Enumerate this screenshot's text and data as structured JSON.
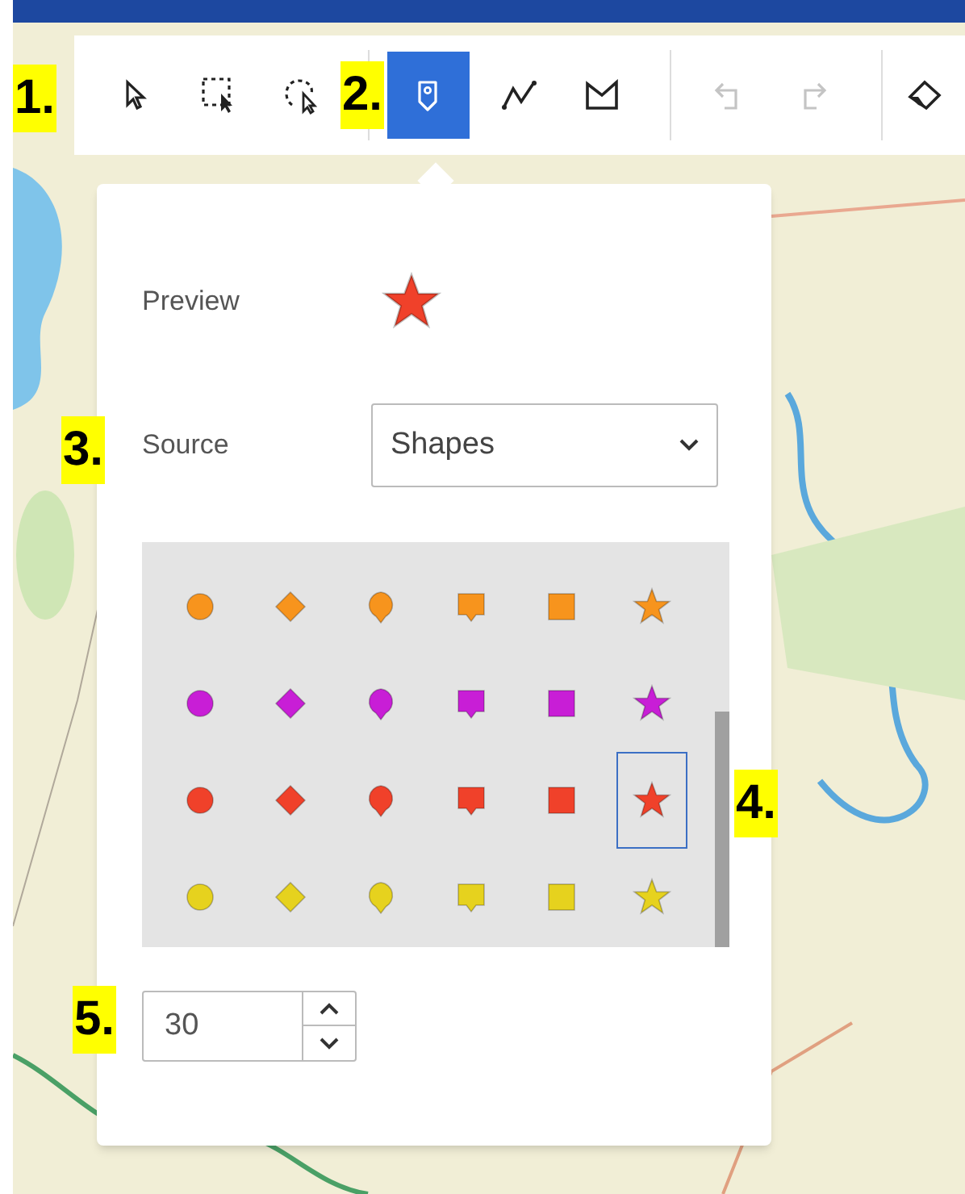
{
  "toolbar": {
    "tools": [
      {
        "kind": "select",
        "selected": false,
        "disabled": false
      },
      {
        "kind": "rectangle-select",
        "selected": false,
        "disabled": false
      },
      {
        "kind": "lasso-select",
        "selected": false,
        "disabled": false
      },
      {
        "kind": "point",
        "selected": true,
        "disabled": false
      },
      {
        "kind": "polyline",
        "selected": false,
        "disabled": false
      },
      {
        "kind": "polygon",
        "selected": false,
        "disabled": false
      },
      {
        "kind": "undo",
        "selected": false,
        "disabled": true
      },
      {
        "kind": "redo",
        "selected": false,
        "disabled": true
      },
      {
        "kind": "eraser",
        "selected": false,
        "disabled": false
      }
    ]
  },
  "symbol_panel": {
    "preview_label": "Preview",
    "preview": {
      "kind": "star",
      "color": "#f0412a"
    },
    "source_label": "Source",
    "source": {
      "value": "Shapes"
    },
    "symbols": [
      {
        "color": "#f7941d",
        "items": [
          {
            "kind": "circle",
            "selected": false
          },
          {
            "kind": "diamond",
            "selected": false
          },
          {
            "kind": "pin",
            "selected": false
          },
          {
            "kind": "callout",
            "selected": false
          },
          {
            "kind": "square",
            "selected": false
          },
          {
            "kind": "star",
            "selected": false
          }
        ]
      },
      {
        "color": "#c81ed6",
        "items": [
          {
            "kind": "circle",
            "selected": false
          },
          {
            "kind": "diamond",
            "selected": false
          },
          {
            "kind": "pin",
            "selected": false
          },
          {
            "kind": "callout",
            "selected": false
          },
          {
            "kind": "square",
            "selected": false
          },
          {
            "kind": "star",
            "selected": false
          }
        ]
      },
      {
        "color": "#f0412a",
        "items": [
          {
            "kind": "circle",
            "selected": false
          },
          {
            "kind": "diamond",
            "selected": false
          },
          {
            "kind": "pin",
            "selected": false
          },
          {
            "kind": "callout",
            "selected": false
          },
          {
            "kind": "square",
            "selected": false
          },
          {
            "kind": "star",
            "selected": true
          }
        ]
      },
      {
        "color": "#e6d21e",
        "items": [
          {
            "kind": "circle",
            "selected": false
          },
          {
            "kind": "diamond",
            "selected": false
          },
          {
            "kind": "pin",
            "selected": false
          },
          {
            "kind": "callout",
            "selected": false
          },
          {
            "kind": "square",
            "selected": false
          },
          {
            "kind": "star",
            "selected": false
          }
        ]
      }
    ],
    "size": {
      "value": "30"
    }
  },
  "callouts": [
    "1.",
    "2.",
    "3.",
    "4.",
    "5."
  ]
}
